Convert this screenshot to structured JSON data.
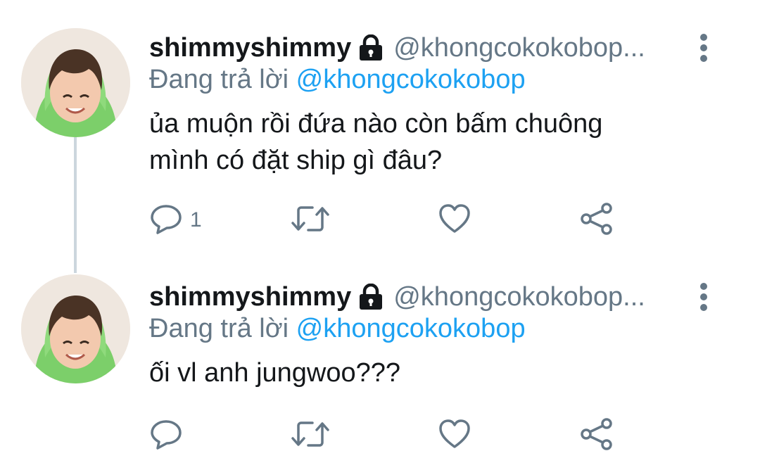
{
  "tweets": [
    {
      "display_name": "shimmyshimmy",
      "handle": "@khongcokokobop...",
      "replying_prefix": "Đang trả lời",
      "replying_to": "@khongcokokobop",
      "text_lines": [
        "ủa muộn rồi đứa nào còn bấm chuông",
        "mình có đặt ship gì đâu?"
      ],
      "reply_count": "1",
      "icons": [
        "lock-icon",
        "more-vertical-icon",
        "reply-icon",
        "retweet-icon",
        "like-icon",
        "share-icon"
      ]
    },
    {
      "display_name": "shimmyshimmy",
      "handle": "@khongcokokobop...",
      "replying_prefix": "Đang trả lời",
      "replying_to": "@khongcokokobop",
      "text_lines": [
        "ối vl anh jungwoo???"
      ],
      "reply_count": "",
      "icons": [
        "lock-icon",
        "more-vertical-icon",
        "reply-icon",
        "retweet-icon",
        "like-icon",
        "share-icon"
      ]
    }
  ],
  "colors": {
    "text": "#14171a",
    "muted": "#657786",
    "link": "#1da1f2",
    "thread_line": "#ccd6dd",
    "hoodie": "#7ccf6a"
  }
}
